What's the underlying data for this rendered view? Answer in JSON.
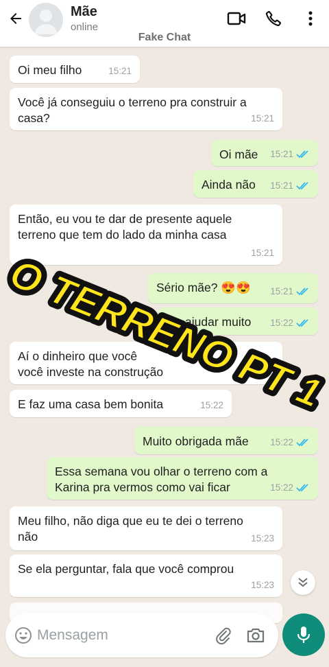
{
  "header": {
    "contact_name": "Mãe",
    "contact_status": "online",
    "app_label": "Fake Chat"
  },
  "messages": [
    {
      "dir": "in",
      "lines": [
        "Oi meu filho"
      ],
      "time": "15:21"
    },
    {
      "dir": "in",
      "lines": [
        "Você já conseguiu o terreno pra construir a",
        "casa?"
      ],
      "time": "15:21"
    },
    {
      "dir": "out",
      "lines": [
        "Oi mãe"
      ],
      "time": "15:21",
      "read": true
    },
    {
      "dir": "out",
      "lines": [
        "Ainda não"
      ],
      "time": "15:21",
      "read": true
    },
    {
      "dir": "in",
      "lines": [
        "Então, eu vou te dar de presente aquele",
        "terreno que tem do lado da minha casa"
      ],
      "time": "15:21"
    },
    {
      "dir": "out",
      "lines": [
        "Sério mãe? 😍😍"
      ],
      "time": "15:21",
      "read": true
    },
    {
      "dir": "out",
      "lines": [
        "ajudar muito"
      ],
      "time": "15:22",
      "read": true
    },
    {
      "dir": "in",
      "lines": [
        "Aí o dinheiro que você",
        "você investe na construção"
      ],
      "time": ""
    },
    {
      "dir": "in",
      "lines": [
        "E faz uma casa bem bonita"
      ],
      "time": "15:22"
    },
    {
      "dir": "out",
      "lines": [
        "Muito obrigada mãe"
      ],
      "time": "15:22",
      "read": true
    },
    {
      "dir": "out",
      "lines": [
        "Essa semana vou olhar o terreno com a",
        "Karina pra vermos como vai ficar"
      ],
      "time": "15:22",
      "read": true
    },
    {
      "dir": "in",
      "lines": [
        "Meu filho, não diga que eu te dei o terreno",
        "não"
      ],
      "time": "15:23"
    },
    {
      "dir": "in",
      "lines": [
        "Se ela perguntar, fala que você comprou"
      ],
      "time": "15:23"
    }
  ],
  "overlay": {
    "title": "O TERRENO PT 1",
    "fill_color": "#ffe51a",
    "outline_color": "#111111"
  },
  "input": {
    "placeholder": "Mensagem"
  },
  "colors": {
    "incoming_bubble": "#ffffff",
    "outgoing_bubble": "#e1f8cb",
    "read_tick": "#34b7f1",
    "accent": "#0f8c7a"
  },
  "icons": [
    "back-arrow-icon",
    "video-call-icon",
    "phone-icon",
    "more-options-icon",
    "double-check-icon",
    "emoji-icon",
    "attach-icon",
    "camera-icon",
    "mic-icon",
    "chevron-down-icon"
  ]
}
